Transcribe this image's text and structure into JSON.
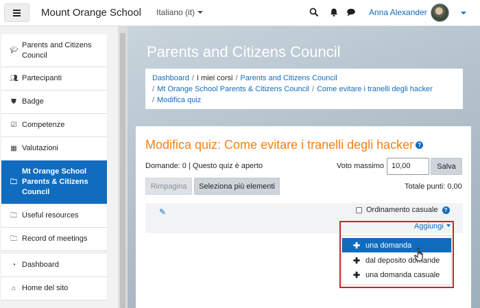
{
  "navbar": {
    "brand": "Mount Orange School",
    "language": "Italiano (it)",
    "user_name": "Anna Alexander",
    "icons": [
      "search-icon",
      "bell-icon",
      "chat-icon",
      "chevron-down-icon"
    ]
  },
  "sidebar": {
    "items": [
      {
        "label": "Parents and Citizens Council",
        "icon": "graduation-cap-icon"
      },
      {
        "label": "Partecipanti",
        "icon": "users-icon"
      },
      {
        "label": "Badge",
        "icon": "shield-icon"
      },
      {
        "label": "Competenze",
        "icon": "check-square-icon"
      },
      {
        "label": "Valutazioni",
        "icon": "table-icon"
      },
      {
        "label": "Mt Orange School Parents & Citizens Council",
        "icon": "folder-icon",
        "active": true
      },
      {
        "label": "Useful resources",
        "icon": "folder-icon"
      },
      {
        "label": "Record of meetings",
        "icon": "folder-icon"
      },
      {
        "label": "Dashboard",
        "icon": "dashboard-icon"
      },
      {
        "label": "Home del sito",
        "icon": "home-icon"
      }
    ]
  },
  "header": {
    "title": "Parents and Citizens Council",
    "breadcrumb": [
      "Dashboard",
      "I miei corsi",
      "Parents and Citizens Council",
      "Mt Orange School Parents & Citizens Council",
      "Come evitare i tranelli degli hacker",
      "Modifica quiz"
    ]
  },
  "quiz": {
    "title": "Modifica quiz: Come evitare i tranelli degli hacker",
    "info": "Domande: 0 | Questo quiz è aperto",
    "voto_label": "Voto massimo",
    "voto_value": "10,00",
    "salva_label": "Salva",
    "rimpagina_label": "Rimpagina",
    "seleziona_label": "Seleziona più elementi",
    "totale_label": "Totale punti: 0,00",
    "ordinamento_label": "Ordinamento casuale",
    "aggiungi_label": "Aggiungi",
    "add_menu": [
      {
        "label": "una domanda",
        "active": true
      },
      {
        "label": "dal deposito domande",
        "active": false
      },
      {
        "label": "una domanda casuale",
        "active": false
      }
    ]
  },
  "colors": {
    "accent": "#0f6cbf",
    "title_orange": "#f98012",
    "highlight_red": "#d0202a"
  }
}
